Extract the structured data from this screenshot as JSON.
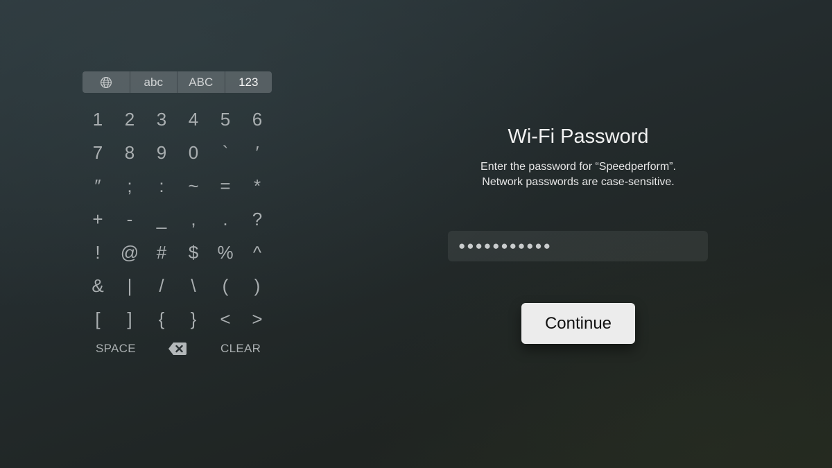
{
  "keyboard": {
    "modes": [
      {
        "id": "language",
        "icon": "globe-icon",
        "label": ""
      },
      {
        "id": "lowercase",
        "label": "abc"
      },
      {
        "id": "uppercase",
        "label": "ABC"
      },
      {
        "id": "numbers",
        "label": "123",
        "active": true
      }
    ],
    "keys": [
      "1",
      "2",
      "3",
      "4",
      "5",
      "6",
      "7",
      "8",
      "9",
      "0",
      "`",
      "′",
      "″",
      ";",
      ":",
      "~",
      "=",
      "*",
      "+",
      "-",
      "_",
      ",",
      ".",
      "?",
      "!",
      "@",
      "#",
      "$",
      "%",
      "^",
      "&",
      "|",
      "/",
      "\\",
      "(",
      ")",
      "[",
      "]",
      "{",
      "}",
      "<",
      ">"
    ],
    "space_label": "SPACE",
    "delete_icon": "delete-backspace-icon",
    "clear_label": "CLEAR"
  },
  "dialog": {
    "title": "Wi-Fi Password",
    "subtitle_line1": "Enter the password for “Speedperform”.",
    "subtitle_line2": "Network passwords are case-sensitive.",
    "password_masked": "●●●●●●●●●●●",
    "continue_label": "Continue"
  },
  "colors": {
    "background": "#262e30",
    "key_text": "#a9aeb0",
    "mode_bar": "#5f676a",
    "button_bg": "#ececec",
    "button_text": "#111111"
  }
}
